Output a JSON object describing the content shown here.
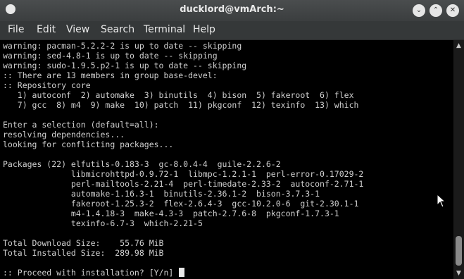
{
  "window": {
    "title": "ducklord@vmArch:~",
    "controls": [
      {
        "name": "minimize",
        "glyph": "⌄"
      },
      {
        "name": "maximize",
        "glyph": "⌃"
      },
      {
        "name": "close",
        "glyph": "✕"
      }
    ]
  },
  "menubar": {
    "items": [
      "File",
      "Edit",
      "View",
      "Search",
      "Terminal",
      "Help"
    ]
  },
  "terminal": {
    "lines": [
      "warning: pacman-5.2.2-2 is up to date -- skipping",
      "warning: sed-4.8-1 is up to date -- skipping",
      "warning: sudo-1.9.5.p2-1 is up to date -- skipping",
      ":: There are 13 members in group base-devel:",
      ":: Repository core",
      "   1) autoconf  2) automake  3) binutils  4) bison  5) fakeroot  6) flex",
      "   7) gcc  8) m4  9) make  10) patch  11) pkgconf  12) texinfo  13) which",
      "",
      "Enter a selection (default=all):",
      "resolving dependencies...",
      "looking for conflicting packages...",
      "",
      "Packages (22) elfutils-0.183-3  gc-8.0.4-4  guile-2.2.6-2",
      "              libmicrohttpd-0.9.72-1  libmpc-1.2.1-1  perl-error-0.17029-2",
      "              perl-mailtools-2.21-4  perl-timedate-2.33-2  autoconf-2.71-1",
      "              automake-1.16.3-1  binutils-2.36.1-2  bison-3.7.3-1",
      "              fakeroot-1.25.3-2  flex-2.6.4-3  gcc-10.2.0-6  git-2.30.1-1",
      "              m4-1.4.18-3  make-4.3-3  patch-2.7.6-8  pkgconf-1.7.3-1",
      "              texinfo-6.7-3  which-2.21-5",
      "",
      "Total Download Size:    55.76 MiB",
      "Total Installed Size:  289.98 MiB",
      "",
      ":: Proceed with installation? [Y/n] "
    ]
  },
  "colors": {
    "titlebar": "#3d4041",
    "menubar": "#353839",
    "terminal_bg": "#000000",
    "terminal_fg": "#d0d0d0"
  },
  "icons": [
    "window-menu-icon",
    "minimize-icon",
    "maximize-icon",
    "close-icon",
    "scroll-up-icon",
    "scroll-down-icon",
    "mouse-pointer-icon"
  ]
}
